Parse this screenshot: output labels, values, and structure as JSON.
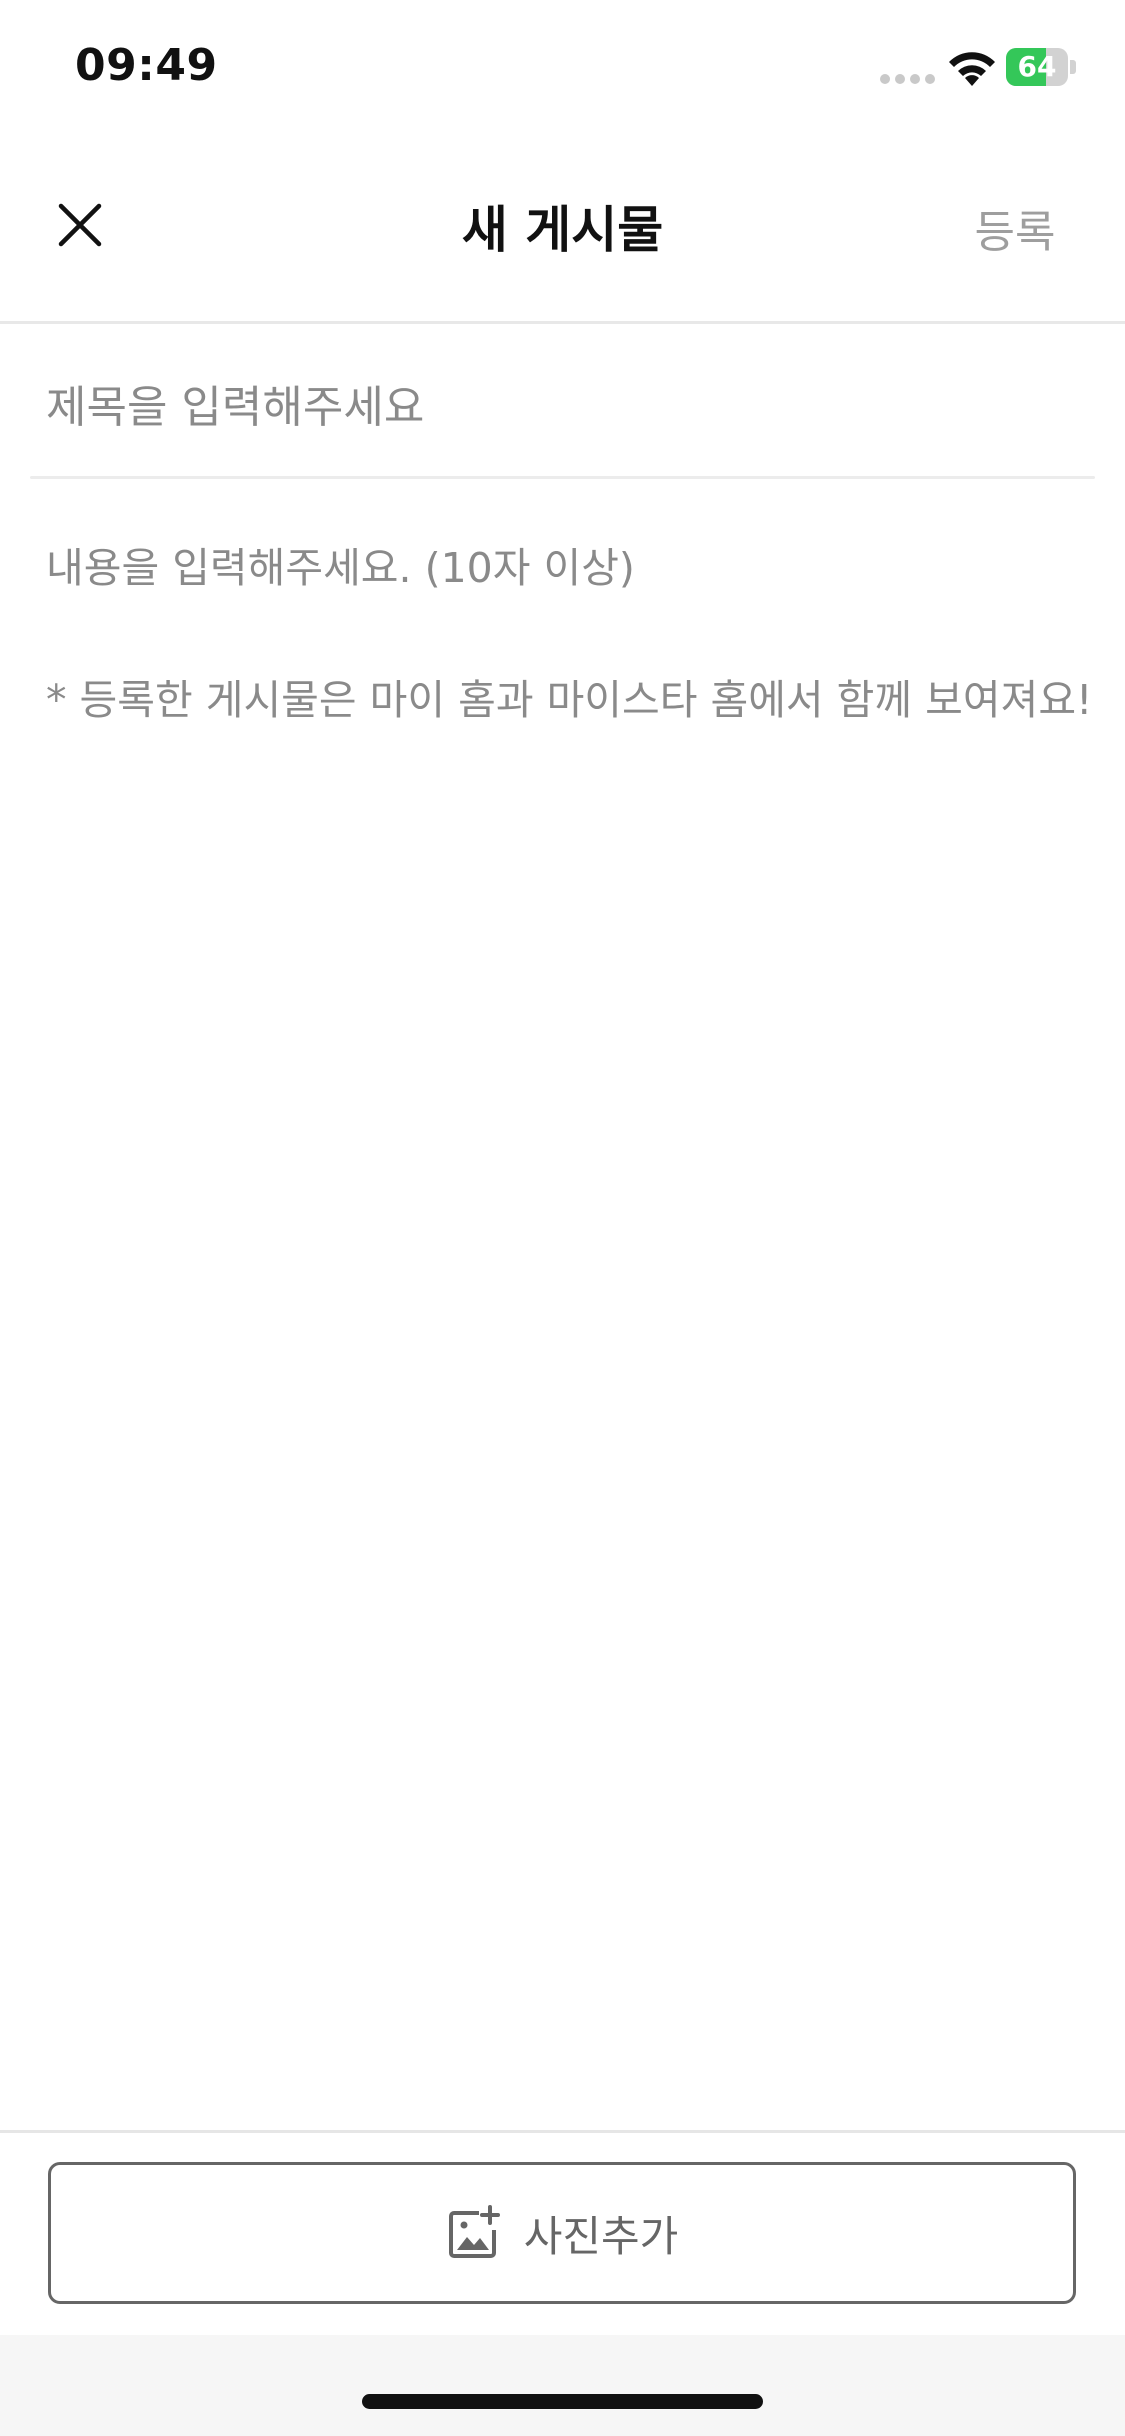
{
  "status_bar": {
    "time": "09:49",
    "battery_level": "64",
    "battery_fraction": 0.64,
    "battery_color": "#34c759",
    "icons": [
      "signal-dots-icon",
      "wifi-icon",
      "battery-charging-icon"
    ]
  },
  "header": {
    "close_icon": "close-icon",
    "title": "새 게시물",
    "submit_label": "등록",
    "submit_color": "#9e9e9e"
  },
  "form": {
    "title_placeholder": "제목을 입력해주세요",
    "title_value": "",
    "content_placeholder": "내용을 입력해주세요. (10자 이상)\n\n* 등록한 게시물은 마이 홈과 마이스타 홈에서 함께 보여져요!",
    "content_value": ""
  },
  "bottom": {
    "photo_icon": "add-photo-icon",
    "photo_label": "사진추가"
  }
}
